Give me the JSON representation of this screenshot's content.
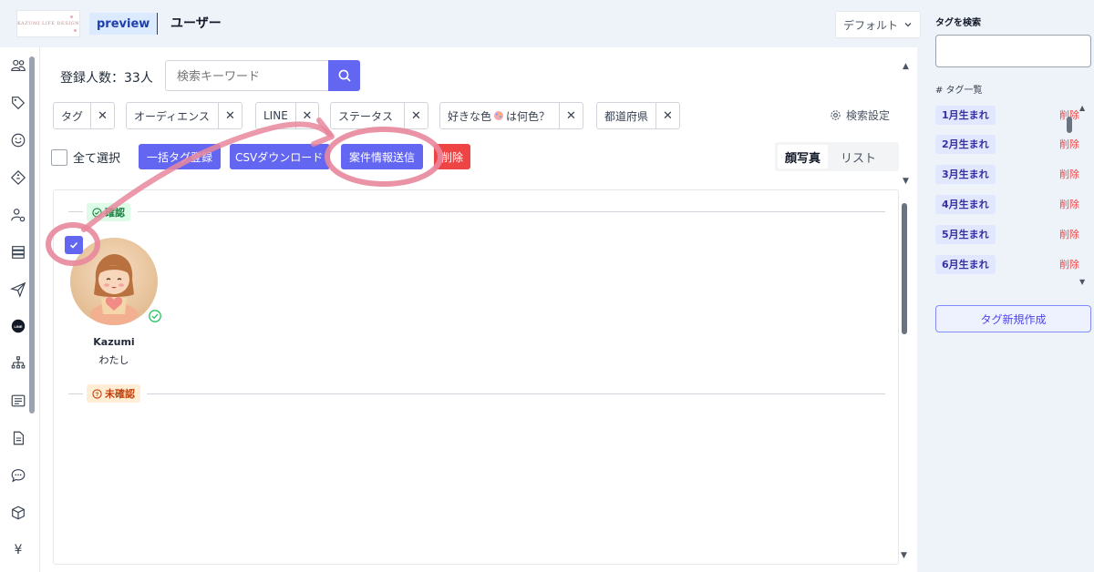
{
  "header": {
    "logo_text": "KAZUMI LIFE DESIGN",
    "preview_label": "preview",
    "title": "ユーザー",
    "view_select": "デフォルト"
  },
  "rail": {
    "icons": [
      "users-icon",
      "tag-icon",
      "smile-icon",
      "ticket-icon",
      "user-settings-icon",
      "database-icon",
      "send-icon",
      "line-icon",
      "sitemap-icon",
      "list-icon",
      "document-icon",
      "chat-icon",
      "cube-icon",
      "yen-icon"
    ],
    "line_label": "LINE",
    "yen_label": "¥"
  },
  "toolbar": {
    "count_label": "登録人数：33人",
    "search_placeholder": "検索キーワード",
    "search_settings": "検索設定"
  },
  "filters": [
    {
      "label": "タグ"
    },
    {
      "label": "オーディエンス"
    },
    {
      "label": "LINE"
    },
    {
      "label": "ステータス"
    },
    {
      "label_before": "好きな色",
      "label_after": "は何色？",
      "has_emoji": true
    },
    {
      "label": "都道府県"
    }
  ],
  "actions": {
    "select_all": "全て選択",
    "bulk_tag": "一括タグ登録",
    "csv_download": "CSVダウンロード",
    "send_info": "案件情報送信",
    "delete": "削除"
  },
  "view_tabs": {
    "face_photo": "顔写真",
    "list": "リスト"
  },
  "groups": {
    "confirmed": "確認",
    "unconfirmed": "未確認"
  },
  "user": {
    "name": "Kazumi",
    "nickname": "わたし",
    "selected": true,
    "verified": true
  },
  "sidebar": {
    "search_title": "タグを検索",
    "list_title": "# タグ一覧",
    "delete_label": "削除",
    "new_tag_button": "タグ新規作成",
    "tags": [
      {
        "label": "1月生まれ"
      },
      {
        "label": "2月生まれ"
      },
      {
        "label": "3月生まれ"
      },
      {
        "label": "4月生まれ"
      },
      {
        "label": "5月生まれ"
      },
      {
        "label": "6月生まれ"
      }
    ]
  },
  "colors": {
    "accent": "#6366f1",
    "danger": "#ef4444",
    "annotation": "#e8879c",
    "confirmed": "#15803d",
    "unconfirmed": "#c2410c"
  }
}
